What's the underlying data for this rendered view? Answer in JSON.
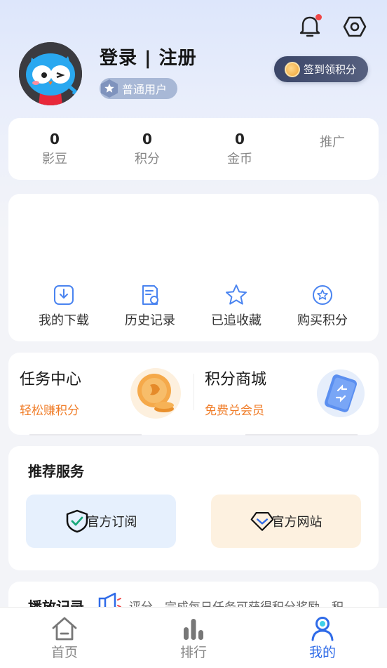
{
  "header": {
    "username": "登录 | 注册",
    "user_level": "普通用户",
    "checkin_label": "签到领积分"
  },
  "stats": [
    {
      "value": "0",
      "label": "影豆"
    },
    {
      "value": "0",
      "label": "积分"
    },
    {
      "value": "0",
      "label": "金币"
    },
    {
      "value": "",
      "label": "推广"
    }
  ],
  "menu": [
    {
      "label": "我的下载",
      "icon": "download-icon"
    },
    {
      "label": "历史记录",
      "icon": "history-icon"
    },
    {
      "label": "已追收藏",
      "icon": "star-icon"
    },
    {
      "label": "购买积分",
      "icon": "points-icon"
    }
  ],
  "tasks": {
    "left": {
      "title": "任务中心",
      "subtitle": "轻松赚积分"
    },
    "right": {
      "title": "积分商城",
      "subtitle": "免费兑会员"
    }
  },
  "services": {
    "title": "推荐服务",
    "items": [
      {
        "label": "官方订阅",
        "icon": "shield-check-icon"
      },
      {
        "label": "官方网站",
        "icon": "diamond-icon"
      }
    ]
  },
  "history": {
    "title": "播放记录",
    "notice": "评分、完成每日任务可获得积分奖励，积"
  },
  "tabbar": [
    {
      "label": "首页",
      "icon": "home-icon"
    },
    {
      "label": "排行",
      "icon": "ranking-icon"
    },
    {
      "label": "我的",
      "icon": "profile-icon",
      "active": true
    }
  ],
  "colors": {
    "accent": "#2f6be8",
    "orange": "#f07c27",
    "notification_dot": "#f04848"
  }
}
